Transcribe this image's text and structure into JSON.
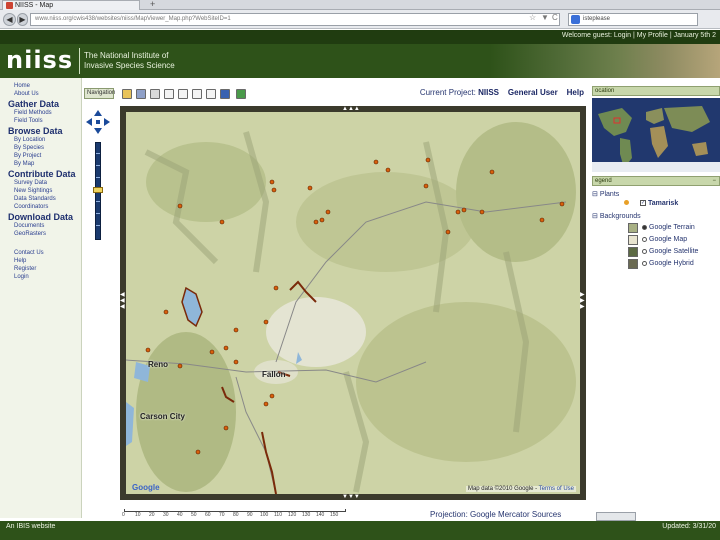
{
  "browser": {
    "tab_title": "NIISS - Map",
    "new_tab": "+",
    "url": "www.niiss.org/cwis438/websites/niiss/MapViewer_Map.php?WebSiteID=1",
    "search_text": "isteplease"
  },
  "header": {
    "logo": "niiss",
    "tagline_line1": "The National Institute of",
    "tagline_line2": "Invasive Species Science",
    "welcome": "Welcome guest: Login",
    "my_profile": "My Profile",
    "date": "January 5th 2"
  },
  "sidebar": {
    "home": "Home",
    "about": "About Us",
    "gather": {
      "heading": "Gather Data",
      "items": [
        "Field Methods",
        "Field Tools"
      ]
    },
    "browse": {
      "heading": "Browse Data",
      "items": [
        "By Location",
        "By Species",
        "By Project",
        "By Map"
      ]
    },
    "contribute": {
      "heading": "Contribute Data",
      "items": [
        "Survey Data",
        "New Sightings",
        "Data Standards",
        "Coordinators"
      ]
    },
    "download": {
      "heading": "Download Data",
      "items": [
        "Documents",
        "GeoRasters"
      ]
    },
    "other": [
      "Contact Us",
      "Help",
      "Register",
      "Login"
    ]
  },
  "toolbar": {
    "navigation_label": "Navigation",
    "project_prefix": "Current Project:",
    "project_name": "NIISS",
    "user": "General User",
    "help": "Help"
  },
  "map": {
    "labels": {
      "reno": "Reno",
      "fallon": "Fallon",
      "carson_city": "Carson City"
    },
    "google_logo": "Google",
    "copyright_text": "Map data ©2010 Google -",
    "terms": "Terms of Use"
  },
  "right_panel": {
    "location_head": "ocation",
    "legend_head": "egend",
    "plants_label": "Plants",
    "tamarisk_label": "Tamarisk",
    "backgrounds_label": "Backgrounds",
    "backgrounds": [
      "Google Terrain",
      "Google Map",
      "Google Satellite",
      "Google Hybrid"
    ],
    "minus": "−"
  },
  "scale": {
    "ticks": [
      "0",
      "10",
      "20",
      "30",
      "40",
      "50",
      "60",
      "70",
      "80",
      "90",
      "100",
      "110",
      "120",
      "130",
      "140",
      "150"
    ]
  },
  "bottom": {
    "projection_prefix": "Projection:",
    "projection_value": "Google Mercator",
    "sources": "Sources"
  },
  "footer": {
    "left": "An IBIS website",
    "right": "Updated: 3/31/20"
  },
  "colors": {
    "header_green": "#2e5219",
    "link_blue": "#2a3e8f",
    "tamarisk_marker": "#e8a028"
  }
}
